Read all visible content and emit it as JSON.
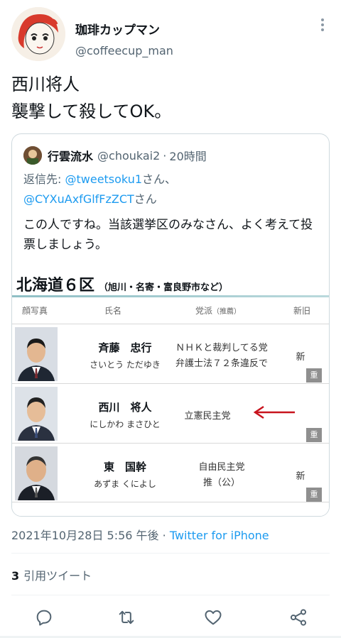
{
  "author": {
    "name": "珈琲カップマン",
    "handle": "@coffeecup_man",
    "avatar_icon": "cartoon-face-avatar",
    "more_icon": "more-vertical-icon"
  },
  "tweet": {
    "text": "西川将人\n襲撃して殺してOK。"
  },
  "quote": {
    "name": "行雲流水",
    "handle": "@choukai2",
    "separator": "·",
    "time": "20時間",
    "reply_prefix": "返信先: ",
    "reply_user1": "@tweetsoku1",
    "reply_san1": "さん、",
    "reply_user2": "@CYXuAxfGlfFzZCT",
    "reply_san2": "さん",
    "body": "この人ですね。当該選挙区のみなさん、よく考えて投票しましょう。",
    "image": {
      "title": "北海道６区",
      "subtitle": "（旭川・名寄・富良野市など）",
      "headers": {
        "photo": "顔写真",
        "name": "氏名",
        "party": "党派",
        "recommend": "（推薦）",
        "status": "新旧"
      },
      "candidates": [
        {
          "kanji": "斉藤　忠行",
          "kana": "さいとう ただゆき",
          "party_line1": "ＮＨＫと裁判してる党",
          "party_line2": "弁護士法７２条違反で",
          "status": "新",
          "badge": "重"
        },
        {
          "kanji": "西川　将人",
          "kana": "にしかわ まさひと",
          "party_line1": "立憲民主党",
          "status": "",
          "badge": "重"
        },
        {
          "kanji": "東　国幹",
          "kana": "あずま くによし",
          "party_line1": "自由民主党",
          "party_line2": "推（公）",
          "status": "新",
          "badge": "重"
        }
      ],
      "arrow_color": "#c8141e"
    }
  },
  "meta": {
    "datetime": "2021年10月28日 5:56 午後",
    "separator": "·",
    "source": "Twitter for iPhone"
  },
  "stats": {
    "quote_count": "3",
    "quote_label": "引用ツイート"
  },
  "actions": {
    "reply_icon": "reply-icon",
    "retweet_icon": "retweet-icon",
    "like_icon": "heart-icon",
    "share_icon": "share-icon"
  },
  "colors": {
    "link": "#1d9bf0",
    "secondary": "#536471",
    "border": "#cfd9de"
  }
}
